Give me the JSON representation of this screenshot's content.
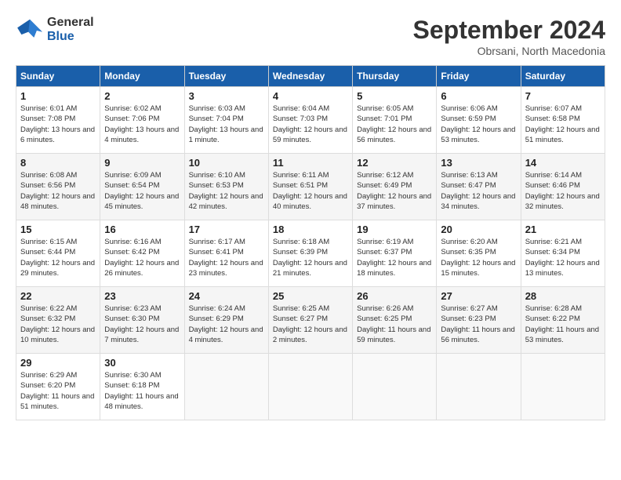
{
  "header": {
    "logo_line1": "General",
    "logo_line2": "Blue",
    "month": "September 2024",
    "location": "Obrsani, North Macedonia"
  },
  "days_of_week": [
    "Sunday",
    "Monday",
    "Tuesday",
    "Wednesday",
    "Thursday",
    "Friday",
    "Saturday"
  ],
  "weeks": [
    [
      {
        "day": "1",
        "sunrise": "6:01 AM",
        "sunset": "7:08 PM",
        "daylight": "13 hours and 6 minutes."
      },
      {
        "day": "2",
        "sunrise": "6:02 AM",
        "sunset": "7:06 PM",
        "daylight": "13 hours and 4 minutes."
      },
      {
        "day": "3",
        "sunrise": "6:03 AM",
        "sunset": "7:04 PM",
        "daylight": "13 hours and 1 minute."
      },
      {
        "day": "4",
        "sunrise": "6:04 AM",
        "sunset": "7:03 PM",
        "daylight": "12 hours and 59 minutes."
      },
      {
        "day": "5",
        "sunrise": "6:05 AM",
        "sunset": "7:01 PM",
        "daylight": "12 hours and 56 minutes."
      },
      {
        "day": "6",
        "sunrise": "6:06 AM",
        "sunset": "6:59 PM",
        "daylight": "12 hours and 53 minutes."
      },
      {
        "day": "7",
        "sunrise": "6:07 AM",
        "sunset": "6:58 PM",
        "daylight": "12 hours and 51 minutes."
      }
    ],
    [
      {
        "day": "8",
        "sunrise": "6:08 AM",
        "sunset": "6:56 PM",
        "daylight": "12 hours and 48 minutes."
      },
      {
        "day": "9",
        "sunrise": "6:09 AM",
        "sunset": "6:54 PM",
        "daylight": "12 hours and 45 minutes."
      },
      {
        "day": "10",
        "sunrise": "6:10 AM",
        "sunset": "6:53 PM",
        "daylight": "12 hours and 42 minutes."
      },
      {
        "day": "11",
        "sunrise": "6:11 AM",
        "sunset": "6:51 PM",
        "daylight": "12 hours and 40 minutes."
      },
      {
        "day": "12",
        "sunrise": "6:12 AM",
        "sunset": "6:49 PM",
        "daylight": "12 hours and 37 minutes."
      },
      {
        "day": "13",
        "sunrise": "6:13 AM",
        "sunset": "6:47 PM",
        "daylight": "12 hours and 34 minutes."
      },
      {
        "day": "14",
        "sunrise": "6:14 AM",
        "sunset": "6:46 PM",
        "daylight": "12 hours and 32 minutes."
      }
    ],
    [
      {
        "day": "15",
        "sunrise": "6:15 AM",
        "sunset": "6:44 PM",
        "daylight": "12 hours and 29 minutes."
      },
      {
        "day": "16",
        "sunrise": "6:16 AM",
        "sunset": "6:42 PM",
        "daylight": "12 hours and 26 minutes."
      },
      {
        "day": "17",
        "sunrise": "6:17 AM",
        "sunset": "6:41 PM",
        "daylight": "12 hours and 23 minutes."
      },
      {
        "day": "18",
        "sunrise": "6:18 AM",
        "sunset": "6:39 PM",
        "daylight": "12 hours and 21 minutes."
      },
      {
        "day": "19",
        "sunrise": "6:19 AM",
        "sunset": "6:37 PM",
        "daylight": "12 hours and 18 minutes."
      },
      {
        "day": "20",
        "sunrise": "6:20 AM",
        "sunset": "6:35 PM",
        "daylight": "12 hours and 15 minutes."
      },
      {
        "day": "21",
        "sunrise": "6:21 AM",
        "sunset": "6:34 PM",
        "daylight": "12 hours and 13 minutes."
      }
    ],
    [
      {
        "day": "22",
        "sunrise": "6:22 AM",
        "sunset": "6:32 PM",
        "daylight": "12 hours and 10 minutes."
      },
      {
        "day": "23",
        "sunrise": "6:23 AM",
        "sunset": "6:30 PM",
        "daylight": "12 hours and 7 minutes."
      },
      {
        "day": "24",
        "sunrise": "6:24 AM",
        "sunset": "6:29 PM",
        "daylight": "12 hours and 4 minutes."
      },
      {
        "day": "25",
        "sunrise": "6:25 AM",
        "sunset": "6:27 PM",
        "daylight": "12 hours and 2 minutes."
      },
      {
        "day": "26",
        "sunrise": "6:26 AM",
        "sunset": "6:25 PM",
        "daylight": "11 hours and 59 minutes."
      },
      {
        "day": "27",
        "sunrise": "6:27 AM",
        "sunset": "6:23 PM",
        "daylight": "11 hours and 56 minutes."
      },
      {
        "day": "28",
        "sunrise": "6:28 AM",
        "sunset": "6:22 PM",
        "daylight": "11 hours and 53 minutes."
      }
    ],
    [
      {
        "day": "29",
        "sunrise": "6:29 AM",
        "sunset": "6:20 PM",
        "daylight": "11 hours and 51 minutes."
      },
      {
        "day": "30",
        "sunrise": "6:30 AM",
        "sunset": "6:18 PM",
        "daylight": "11 hours and 48 minutes."
      },
      null,
      null,
      null,
      null,
      null
    ]
  ]
}
